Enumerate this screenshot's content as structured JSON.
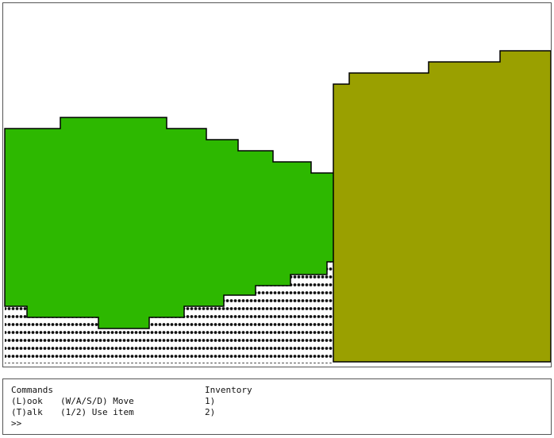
{
  "colors": {
    "left_shape": "#2db800",
    "right_shape": "#9aa000",
    "ground_dots": "#111111",
    "outline": "#000000",
    "background": "#ffffff"
  },
  "panel": {
    "commands_header": "Commands",
    "inventory_header": "Inventory",
    "commands": [
      {
        "key_label": "(L)ook",
        "shortcut_label": "(W/A/S/D) Move"
      },
      {
        "key_label": "(T)alk",
        "shortcut_label": "(1/2) Use item"
      }
    ],
    "inventory_slots": [
      "1)",
      "2)"
    ],
    "prompt": ">>"
  }
}
